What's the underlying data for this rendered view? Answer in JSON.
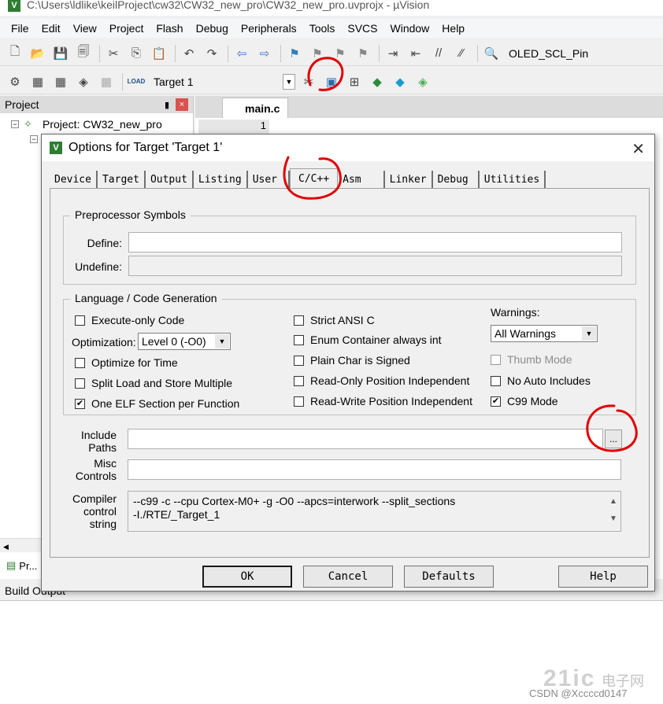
{
  "window": {
    "title": "C:\\Users\\ldlike\\keilProject\\cw32\\CW32_new_pro\\CW32_new_pro.uvprojx - µVision",
    "icon_label": "V"
  },
  "menu": [
    "File",
    "Edit",
    "View",
    "Project",
    "Flash",
    "Debug",
    "Peripherals",
    "Tools",
    "SVCS",
    "Window",
    "Help"
  ],
  "toolbar": {
    "find_text": "OLED_SCL_Pin",
    "target": "Target 1",
    "load_label": "LOAD"
  },
  "project_pane": {
    "title": "Project",
    "close": "×",
    "pin": "📌",
    "root": "Project: CW32_new_pro",
    "tab": "Pr..."
  },
  "editor": {
    "tab": "main.c",
    "line_no": "1"
  },
  "build_output": {
    "title": "Build Output"
  },
  "dialog": {
    "title": "Options for Target 'Target 1'",
    "close": "✕",
    "icon_label": "V",
    "tabs": [
      "Device",
      "Target",
      "Output",
      "Listing",
      "User",
      "C/C++",
      "Asm",
      "Linker",
      "Debug",
      "Utilities"
    ],
    "active_tab": "C/C++",
    "preprocessor": {
      "title": "Preprocessor Symbols",
      "define_label": "Define:",
      "define_value": "",
      "undefine_label": "Undefine:",
      "undefine_value": ""
    },
    "language": {
      "title": "Language / Code Generation",
      "execute_only": "Execute-only Code",
      "optimization_label": "Optimization:",
      "optimization_value": "Level 0 (-O0)",
      "optimize_time": "Optimize for Time",
      "split_load": "Split Load and Store Multiple",
      "one_elf": "One ELF Section per Function",
      "strict_ansi": "Strict ANSI C",
      "enum_container": "Enum Container always int",
      "plain_char": "Plain Char is Signed",
      "ro_pi": "Read-Only Position Independent",
      "rw_pi": "Read-Write Position Independent",
      "warnings_label": "Warnings:",
      "warnings_value": "All Warnings",
      "thumb_mode": "Thumb Mode",
      "no_auto_includes": "No Auto Includes",
      "c99_mode": "C99 Mode",
      "checked_mark": "✔"
    },
    "include_paths": {
      "label1": "Include",
      "label2": "Paths",
      "value": "",
      "browse": "..."
    },
    "misc_controls": {
      "label1": "Misc",
      "label2": "Controls",
      "value": ""
    },
    "compiler_string": {
      "label1": "Compiler",
      "label2": "control",
      "label3": "string",
      "line1": "--c99 -c --cpu Cortex-M0+ -g -O0 --apcs=interwork --split_sections",
      "line2": "-I./RTE/_Target_1"
    },
    "buttons": {
      "ok": "OK",
      "cancel": "Cancel",
      "defaults": "Defaults",
      "help": "Help"
    }
  },
  "watermark": {
    "text": "CSDN @Xccccd0147",
    "logo": "21ic",
    "logo_cn": "电子网"
  },
  "colors": {
    "annotation": "#e00000",
    "dialog_bg": "#f0f0f0"
  }
}
